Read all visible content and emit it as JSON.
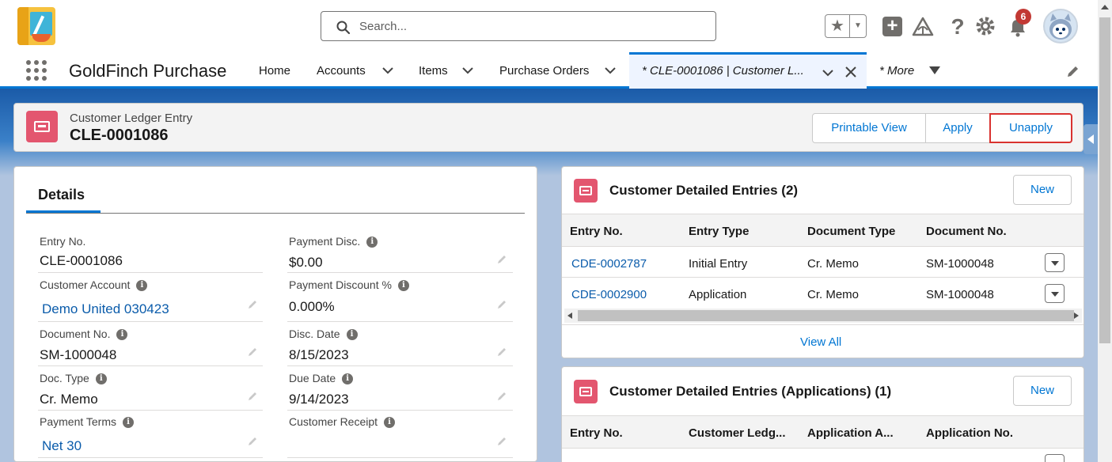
{
  "header": {
    "search_placeholder": "Search...",
    "notification_count": "6"
  },
  "nav": {
    "app_name": "GoldFinch Purchase",
    "items": [
      "Home",
      "Accounts",
      "Items",
      "Purchase Orders"
    ],
    "active_tab": "* CLE-0001086 | Customer L...",
    "more": "* More"
  },
  "record": {
    "type": "Customer Ledger Entry",
    "name": "CLE-0001086",
    "buttons": [
      "Printable View",
      "Apply",
      "Unapply"
    ]
  },
  "details": {
    "tab": "Details",
    "left_fields": [
      {
        "label": "Entry No.",
        "value": "CLE-0001086"
      },
      {
        "label": "Customer Account",
        "value": "Demo United 030423"
      },
      {
        "label": "Document No.",
        "value": "SM-1000048"
      },
      {
        "label": "Doc. Type",
        "value": "Cr. Memo"
      },
      {
        "label": "Payment Terms",
        "value": "Net 30"
      }
    ],
    "right_fields": [
      {
        "label": "Payment Disc.",
        "value": "$0.00"
      },
      {
        "label": "Payment Discount %",
        "value": "0.000%"
      },
      {
        "label": "Disc. Date",
        "value": "8/15/2023"
      },
      {
        "label": "Due Date",
        "value": "9/14/2023"
      },
      {
        "label": "Customer Receipt",
        "value": ""
      }
    ]
  },
  "related1": {
    "title": "Customer Detailed Entries (2)",
    "new_label": "New",
    "columns": [
      "Entry No.",
      "Entry Type",
      "Document Type",
      "Document No."
    ],
    "rows": [
      [
        "CDE-0002787",
        "Initial Entry",
        "Cr. Memo",
        "SM-1000048"
      ],
      [
        "CDE-0002900",
        "Application",
        "Cr. Memo",
        "SM-1000048"
      ]
    ],
    "view_all": "View All"
  },
  "related2": {
    "title": "Customer Detailed Entries (Applications) (1)",
    "new_label": "New",
    "columns": [
      "Entry No.",
      "Customer Ledg...",
      "Application A...",
      "Application No."
    ]
  }
}
